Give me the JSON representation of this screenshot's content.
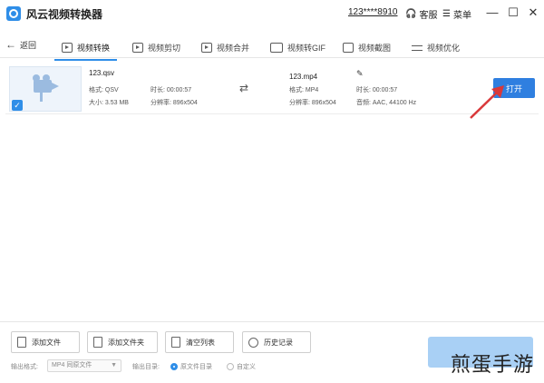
{
  "app": {
    "title": "风云视频转换器",
    "account": "123****8910",
    "service_label": "客服",
    "menu_label": "菜单",
    "window_controls": {
      "minimize": "—",
      "maximize": "☐",
      "close": "✕"
    }
  },
  "nav": {
    "back_label": "返回",
    "items": [
      {
        "label": "视频转换",
        "icon": "play-icon"
      },
      {
        "label": "视频剪切",
        "icon": "scissor-icon"
      },
      {
        "label": "视频合并",
        "icon": "merge-icon"
      },
      {
        "label": "视频转GIF",
        "icon": "gif-icon"
      },
      {
        "label": "视频截图",
        "icon": "image-icon"
      },
      {
        "label": "视频优化",
        "icon": "sliders-icon"
      }
    ]
  },
  "file": {
    "source": {
      "name": "123.qsv",
      "format": "格式: QSV",
      "duration": "时长: 00:00:57",
      "size": "大小: 3.53 MB",
      "resolution": "分辨率: 896x504"
    },
    "target": {
      "name": "123.mp4",
      "format": "格式: MP4",
      "duration": "时长: 00:00:57",
      "resolution": "分辨率: 896x504",
      "audio": "音频: AAC, 44100 Hz"
    },
    "open_label": "打开"
  },
  "toolbar": {
    "add_file": "添加文件",
    "add_folder": "添加文件夹",
    "clear_list": "清空列表",
    "history": "历史记录"
  },
  "options": {
    "output_format_label": "输出格式:",
    "output_format_value": "MP4 同原文件",
    "output_dir_label": "输出目录:",
    "dir_option_source": "原文件目录",
    "dir_option_custom": "自定义"
  },
  "watermark": "煎蛋手游",
  "colors": {
    "accent": "#2f8ee8",
    "button": "#2f7fe0",
    "arrow": "#d9383a"
  }
}
